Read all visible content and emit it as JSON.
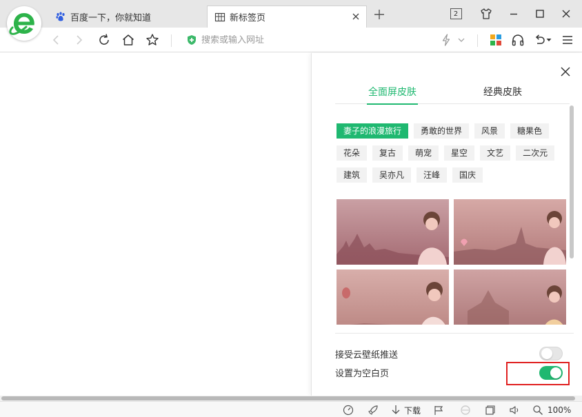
{
  "tabs": [
    {
      "title": "百度一下，你就知道",
      "icon": "baidu-paw-icon"
    },
    {
      "title": "新标签页",
      "icon": "grid-page-icon"
    }
  ],
  "window": {
    "tab_count": "2"
  },
  "address_bar": {
    "placeholder": "搜索或输入网址"
  },
  "panel": {
    "tabs": [
      {
        "label": "全面屏皮肤",
        "active": true
      },
      {
        "label": "经典皮肤",
        "active": false
      }
    ],
    "tags": [
      [
        "妻子的浪漫旅行",
        "勇敢的世界",
        "风景",
        "糖果色"
      ],
      [
        "花朵",
        "复古",
        "萌宠",
        "星空",
        "文艺",
        "二次元"
      ],
      [
        "建筑",
        "吴亦凡",
        "汪峰",
        "国庆"
      ]
    ],
    "active_tag": "妻子的浪漫旅行",
    "settings": [
      {
        "label": "接受云壁纸推送",
        "enabled": false
      },
      {
        "label": "设置为空白页",
        "enabled": true
      }
    ]
  },
  "statusbar": {
    "download_label": "下载",
    "zoom": "100%"
  },
  "colors": {
    "accent": "#1fb870",
    "highlight": "#e02020",
    "logo_green": "#2db34a"
  }
}
